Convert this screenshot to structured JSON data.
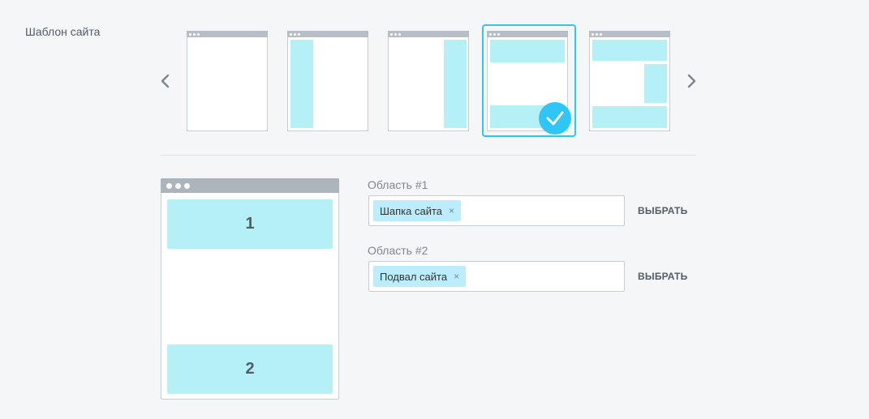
{
  "section": {
    "label": "Шаблон сайта"
  },
  "carousel": {
    "prev_icon": "chevron-left-icon",
    "next_icon": "chevron-right-icon",
    "templates": [
      {
        "name": "empty",
        "selected": false
      },
      {
        "name": "left-sidebar",
        "selected": false
      },
      {
        "name": "right-sidebar",
        "selected": false
      },
      {
        "name": "header-footer",
        "selected": true
      },
      {
        "name": "header-right-footer",
        "selected": false
      }
    ],
    "check_icon": "checkmark-icon",
    "accent_color": "#2fc6f6",
    "block_color": "#b5f0f6"
  },
  "preview": {
    "area1_number": "1",
    "area2_number": "2"
  },
  "areas": [
    {
      "label": "Область #1",
      "tag": "Шапка сайта",
      "remove": "×",
      "button": "ВЫБРАТЬ"
    },
    {
      "label": "Область #2",
      "tag": "Подвал сайта",
      "remove": "×",
      "button": "ВЫБРАТЬ"
    }
  ]
}
